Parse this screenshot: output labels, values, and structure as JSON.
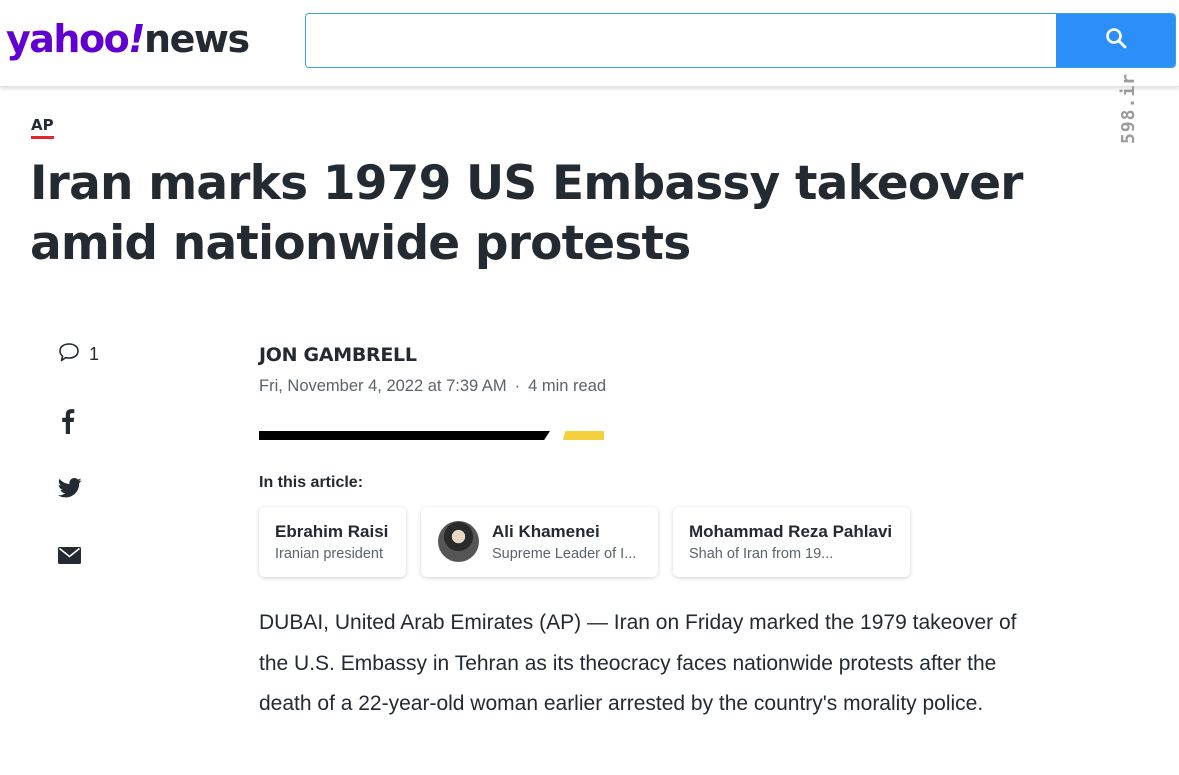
{
  "header": {
    "logo": {
      "yahoo": "yahoo",
      "bang": "!",
      "news": "news"
    },
    "search": {
      "value": "",
      "placeholder": ""
    },
    "watermark": "598.ir",
    "watermark_overlay": "598"
  },
  "article": {
    "provider": "AP",
    "headline": "Iran marks 1979 US Embassy takeover amid nationwide protests",
    "author": "JON GAMBRELL",
    "date": "Fri, November 4, 2022 at 7:39 AM",
    "separator": "·",
    "read_time": "4 min read",
    "in_this_article_label": "In this article:",
    "entities": [
      {
        "name": "Ebrahim Raisi",
        "desc": "Iranian president",
        "has_avatar": false
      },
      {
        "name": "Ali Khamenei",
        "desc": "Supreme Leader of I...",
        "has_avatar": true
      },
      {
        "name": "Mohammad Reza Pahlavi",
        "desc": "Shah of Iran from 19...",
        "has_avatar": false
      }
    ],
    "body": "DUBAI, United Arab Emirates (AP) — Iran on Friday marked the 1979 takeover of the U.S. Embassy in Tehran as its theocracy faces nationwide protests after the death of a 22-year-old woman earlier arrested by the country's morality police."
  },
  "social": {
    "comment_count": "1",
    "icons": [
      "comment-icon",
      "facebook-icon",
      "twitter-icon",
      "email-icon"
    ]
  },
  "colors": {
    "brand_purple": "#6001d2",
    "search_blue": "#2c8ef8",
    "provider_underline": "#e0272c",
    "accent_yellow": "#f4d03f",
    "text_primary": "#232a31",
    "text_secondary": "#5b636a"
  }
}
